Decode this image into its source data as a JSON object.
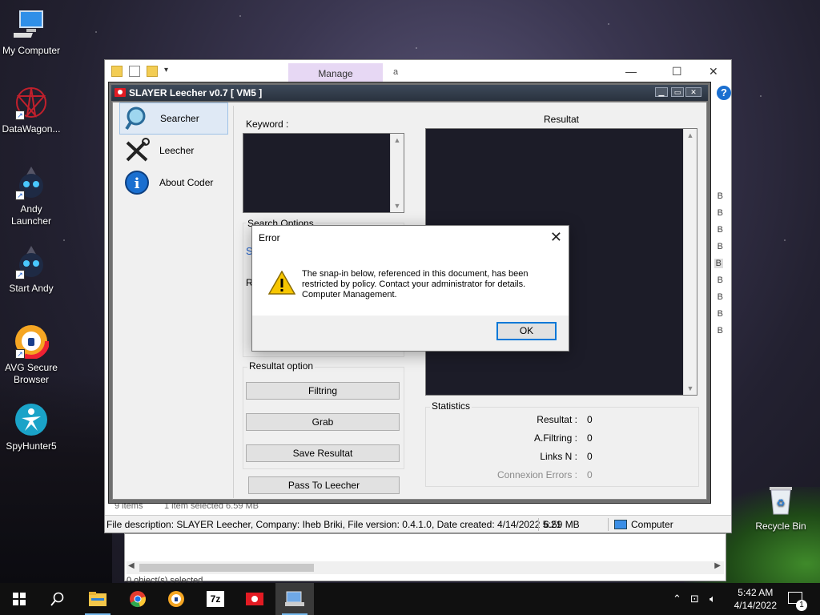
{
  "desktop": {
    "icons": [
      {
        "label": "My Computer"
      },
      {
        "label": "DataWagon..."
      },
      {
        "label": "Andy\nLauncher"
      },
      {
        "label": "Start Andy"
      },
      {
        "label": "AVG Secure\nBrowser"
      },
      {
        "label": "SpyHunter5"
      },
      {
        "label": "Recycle Bin"
      }
    ]
  },
  "explorer": {
    "manage_tab": "Manage",
    "tab_letter": "a",
    "size_unit": "B",
    "status_text": "File description: SLAYER Leecher, Company: Iheb Briki, File version: 0.4.1.0, Date created: 4/14/2022 5:21",
    "status_size": "6.59 MB",
    "status_location": "Computer",
    "behind_status_left": "9 items",
    "behind_status_right": "1 item selected  6.59 MB",
    "lower_status": "0 object(s) selected"
  },
  "slayer": {
    "title": "SLAYER Leecher v0.7 [ VM5 ]",
    "nav": [
      {
        "label": "Searcher"
      },
      {
        "label": "Leecher"
      },
      {
        "label": "About Coder"
      }
    ],
    "keyword_label": "Keyword :",
    "search_options_label": "Search Options",
    "search_options_partial_s": "S",
    "search_options_partial_r": "R",
    "resultat_option_label": "Resultat option",
    "buttons": {
      "filtring": "Filtring",
      "grab": "Grab",
      "save": "Save Resultat",
      "pass": "Pass To Leecher"
    },
    "resultat_label": "Resultat",
    "statistics": {
      "label": "Statistics",
      "rows": [
        {
          "label": "Resultat :",
          "value": "0"
        },
        {
          "label": "A.Filtring :",
          "value": "0"
        },
        {
          "label": "Links N :",
          "value": "0"
        },
        {
          "label": "Connexion Errors :",
          "value": "0"
        }
      ]
    }
  },
  "dialog": {
    "title": "Error",
    "message": "The snap-in below, referenced in this document, has been restricted by policy. Contact your administrator for details.",
    "message_line2": "Computer Management.",
    "ok": "OK"
  },
  "taskbar": {
    "time": "5:42 AM",
    "date": "4/14/2022",
    "notification_count": "1",
    "sevenzip_label": "7z"
  },
  "colors": {
    "accent": "#0078d7",
    "manage_tab": "#e7d8f4",
    "slayer_title": "#2a323e",
    "dark_textbox": "#1c1c28"
  }
}
